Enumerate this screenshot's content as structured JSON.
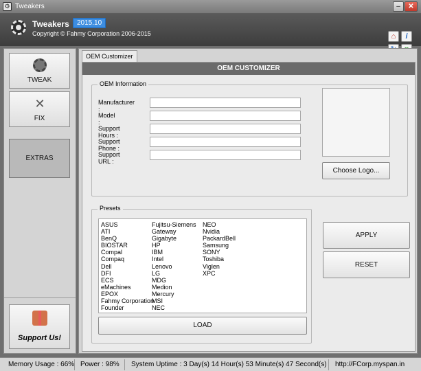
{
  "window": {
    "title": "Tweakers"
  },
  "header": {
    "app_name": "Tweakers",
    "version": "2015.10",
    "copyright": "Copyright © Fahmy Corporation 2006-2015"
  },
  "sidebar": {
    "tweak": "TWEAK",
    "fix": "FIX",
    "extras": "EXTRAS",
    "support": "Support Us!"
  },
  "tab": {
    "label": "OEM Customizer"
  },
  "panel": {
    "heading": "OEM CUSTOMIZER"
  },
  "oem": {
    "legend": "OEM Information",
    "fields": [
      {
        "label": "Manufacturer :",
        "value": ""
      },
      {
        "label": "Model :",
        "value": ""
      },
      {
        "label": "Support Hours :",
        "value": ""
      },
      {
        "label": "Support Phone :",
        "value": ""
      },
      {
        "label": "Support URL :",
        "value": ""
      }
    ],
    "choose_logo": "Choose Logo..."
  },
  "presets": {
    "legend": "Presets",
    "col1": [
      "ASUS",
      "ATI",
      "BenQ",
      "BIOSTAR",
      "Compal",
      "Compaq",
      "Dell",
      "DFI",
      "ECS",
      "eMachines",
      "EPOX",
      "Fahmy Corporation",
      "Founder"
    ],
    "col2": [
      "Fujitsu-Siemens",
      "Gateway",
      "Gigabyte",
      "HP",
      "IBM",
      "Intel",
      "Lenovo",
      "LG",
      "MDG",
      "Medion",
      "Mercury",
      "MSI",
      "NEC"
    ],
    "col3": [
      "NEO",
      "Nvidia",
      "PackardBell",
      "Samsung",
      "SONY",
      "Toshiba",
      "Viglen",
      "XPC"
    ],
    "load": "LOAD"
  },
  "actions": {
    "apply": "APPLY",
    "reset": "RESET"
  },
  "status": {
    "memory": "Memory Usage : 66%",
    "power": "Power : 98%",
    "uptime": "System Uptime : 3 Day(s) 14 Hour(s) 53 Minute(s) 47 Second(s)",
    "url": "http://FCorp.myspan.in"
  }
}
